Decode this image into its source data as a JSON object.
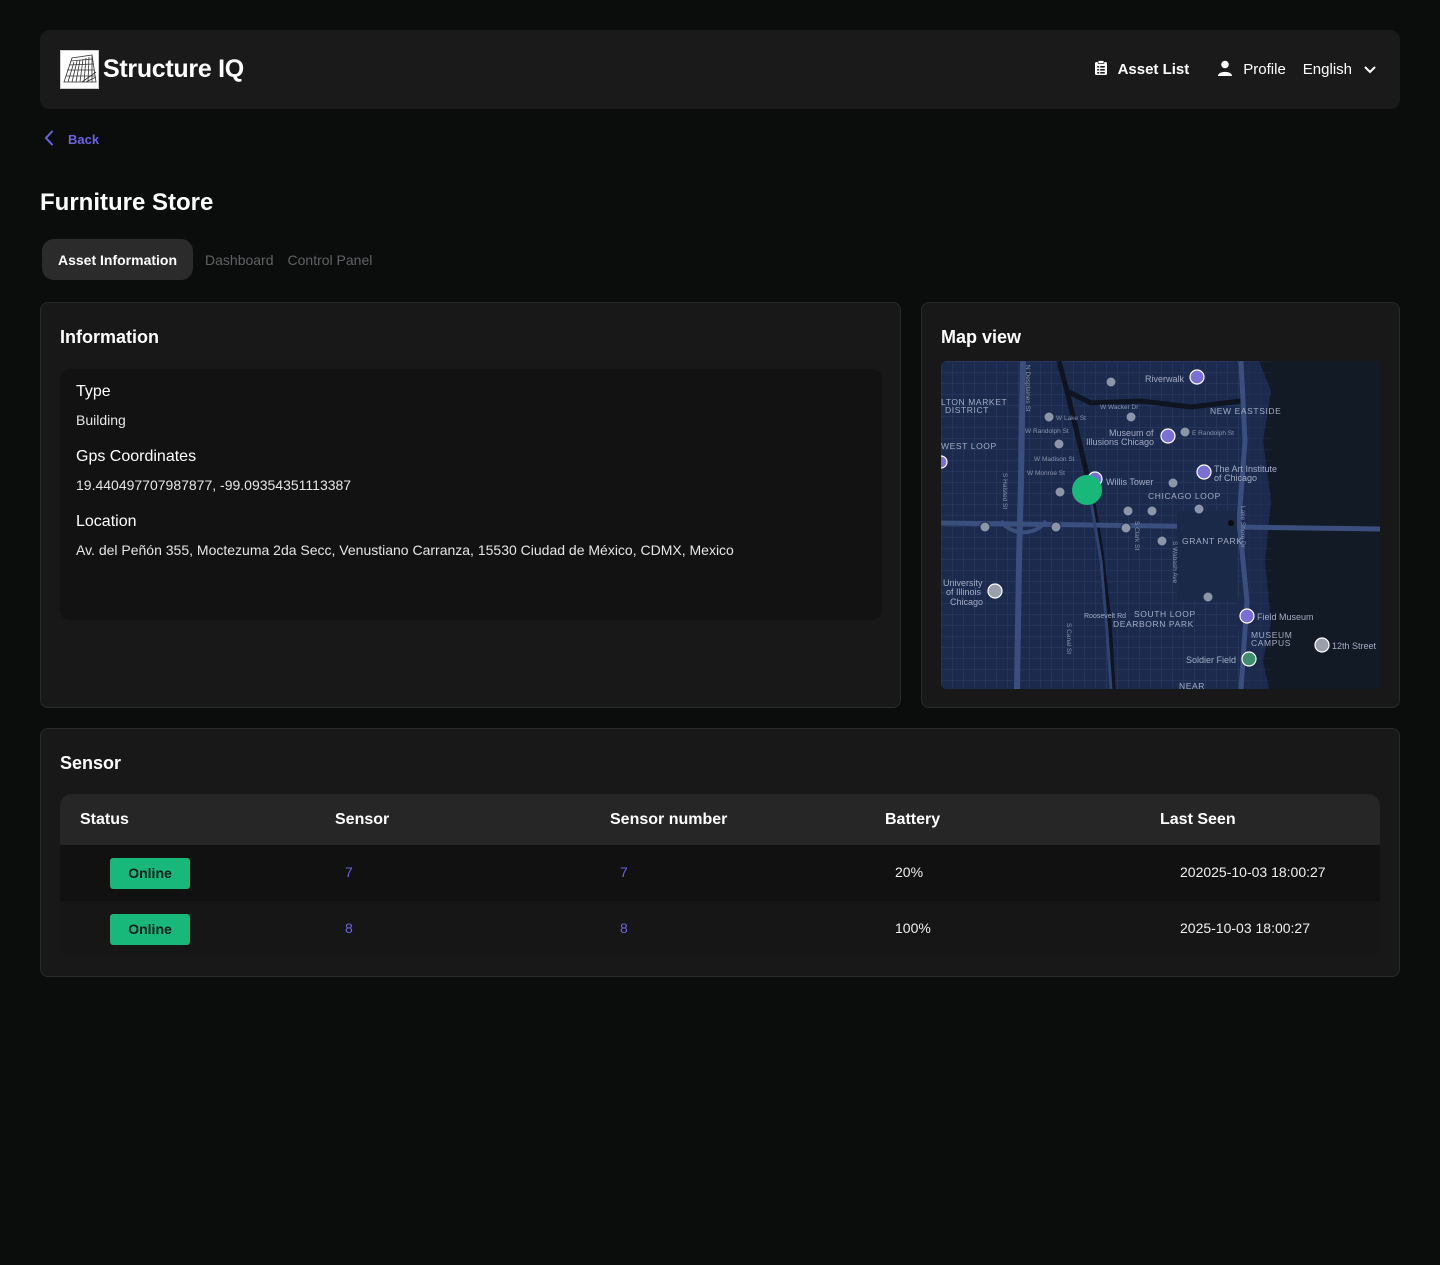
{
  "header": {
    "brand": "Structure IQ",
    "nav_asset_list": "Asset List",
    "nav_profile": "Profile",
    "language": "English"
  },
  "back_label": "Back",
  "page_title": "Furniture Store",
  "tabs": [
    {
      "label": "Asset Information",
      "active": true
    },
    {
      "label": "Dashboard",
      "active": false
    },
    {
      "label": "Control Panel",
      "active": false
    }
  ],
  "information": {
    "title": "Information",
    "fields": [
      {
        "label": "Type",
        "value": "Building"
      },
      {
        "label": "Gps Coordinates",
        "value": "19.440497707987877, -99.09354351113387"
      },
      {
        "label": "Location",
        "value": "Av. del Peñón 355, Moctezuma 2da Secc, Venustiano Carranza, 15530 Ciudad de México, CDMX, Mexico"
      }
    ]
  },
  "map": {
    "title": "Map view",
    "labels": {
      "riverwalk": "Riverwalk",
      "fulton": "LTON MARKET",
      "district": "DISTRICT",
      "new_eastside": "NEW EASTSIDE",
      "west_loop": "WEST LOOP",
      "museum_illusions_1": "Museum of",
      "museum_illusions_2": "Illusions Chicago",
      "art_institute_1": "The Art Institute",
      "art_institute_2": "of Chicago",
      "willis": "Willis Tower",
      "chicago_loop": "CHICAGO LOOP",
      "grant_park": "GRANT PARK",
      "uic_1": "University",
      "uic_2": "of Illinois",
      "uic_3": "Chicago",
      "roosevelt": "Roosevelt Rd",
      "south_loop": "SOUTH LOOP",
      "dearborn": "DEARBORN PARK",
      "field_museum": "Field Museum",
      "museum_campus_1": "MUSEUM",
      "museum_campus_2": "CAMPUS",
      "twelfth": "12th Street",
      "soldier_field": "Soldier Field",
      "near": "NEAR",
      "w_wacker": "W Wacker Dr",
      "w_lake": "W Lake St",
      "w_randolph": "W Randolph St",
      "e_randolph": "E Randolph St",
      "w_madison": "W Madison St",
      "w_monroe": "W Monroe St",
      "lake_shore": "Lake Shore Dr",
      "s_halsted": "S Halsted St",
      "s_canal": "S Canal St",
      "s_clark": "S Clark St",
      "s_wabash": "S Wabash Ave",
      "n_desplaines": "N Desplaines St"
    },
    "colors": {
      "background": "#1b2a4d",
      "marker": "#17b87a",
      "water": "#121a26"
    }
  },
  "sensor": {
    "title": "Sensor",
    "columns": [
      "Status",
      "Sensor",
      "Sensor number",
      "Battery",
      "Last Seen"
    ],
    "rows": [
      {
        "status": "Online",
        "sensor": "7",
        "sensor_number": "7",
        "battery": "20%",
        "last_seen": "202025-10-03 18:00:27"
      },
      {
        "status": "Online",
        "sensor": "8",
        "sensor_number": "8",
        "battery": "100%",
        "last_seen": "2025-10-03 18:00:27"
      }
    ]
  },
  "icons": {
    "logo": "building-sketch-logo",
    "asset_list": "clipboard-icon",
    "profile": "user-icon",
    "language": "chevron-down-icon",
    "back": "chevron-left-icon"
  },
  "colors": {
    "accent": "#6b63e0",
    "online": "#17b87a",
    "background": "#0b0d0d",
    "card": "#181818"
  }
}
